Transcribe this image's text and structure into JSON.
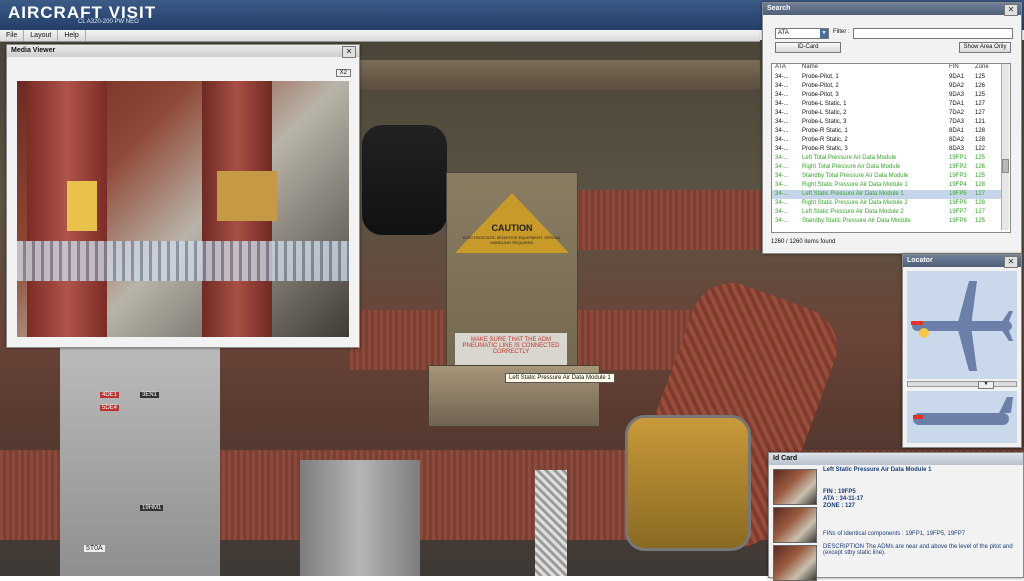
{
  "app": {
    "logo": "AIRCRAFT VISIT",
    "subtitle": "CL A320-200 PW NEO"
  },
  "menu": [
    {
      "label": "File"
    },
    {
      "label": "Layout"
    },
    {
      "label": "Help"
    }
  ],
  "media_viewer": {
    "title": "Media Viewer",
    "zoom_button": "X2"
  },
  "scene": {
    "caution_title": "CAUTION",
    "caution_text": "ELECTROSTATIC SENSITIVE EQUIPMENT. SPECIAL HANDLING REQUIRED",
    "adm_warning": "MAKE SURE THAT THE ADM PNEUMATIC LINE IS CONNECTED CORRECTLY",
    "tooltip": "Left Static Pressure Air Data Module 1",
    "labels": [
      "3EN1",
      "4DE1",
      "5DE4",
      "19HM1",
      "5T0A"
    ]
  },
  "search": {
    "title": "Search",
    "filter_type": "ATA",
    "filter_label": "Filter :",
    "filter_value": "",
    "id_card_button": "ID-Card",
    "show_area_button": "Show Area Only",
    "columns": {
      "ata": "ATA",
      "name": "Name",
      "fin": "FIN",
      "zone": "Zone"
    },
    "rows": [
      {
        "ata": "34-...",
        "name": "Probe-Pitot, 1",
        "fin": "9DA1",
        "zone": "125",
        "green": false,
        "selected": false
      },
      {
        "ata": "34-...",
        "name": "Probe-Pitot, 2",
        "fin": "9DA2",
        "zone": "126",
        "green": false,
        "selected": false
      },
      {
        "ata": "34-...",
        "name": "Probe-Pitot, 3",
        "fin": "9DA3",
        "zone": "125",
        "green": false,
        "selected": false
      },
      {
        "ata": "34-...",
        "name": "Probe-L Static, 1",
        "fin": "7DA1",
        "zone": "127",
        "green": false,
        "selected": false
      },
      {
        "ata": "34-...",
        "name": "Probe-L Static, 2",
        "fin": "7DA2",
        "zone": "127",
        "green": false,
        "selected": false
      },
      {
        "ata": "34-...",
        "name": "Probe-L Static, 3",
        "fin": "7DA3",
        "zone": "121",
        "green": false,
        "selected": false
      },
      {
        "ata": "34-...",
        "name": "Probe-R Static, 1",
        "fin": "8DA1",
        "zone": "128",
        "green": false,
        "selected": false
      },
      {
        "ata": "34-...",
        "name": "Probe-R Static, 2",
        "fin": "8DA2",
        "zone": "128",
        "green": false,
        "selected": false
      },
      {
        "ata": "34-...",
        "name": "Probe-R Static, 3",
        "fin": "8DA3",
        "zone": "122",
        "green": false,
        "selected": false
      },
      {
        "ata": "34-...",
        "name": "Left Total Pressure Air Data Module",
        "fin": "19FP1",
        "zone": "125",
        "green": true,
        "selected": false
      },
      {
        "ata": "34-...",
        "name": "Right Total Pressure Air Data Module",
        "fin": "19FP2",
        "zone": "126",
        "green": true,
        "selected": false
      },
      {
        "ata": "34-...",
        "name": "Standby Total Pressure Air Data Module",
        "fin": "19FP3",
        "zone": "125",
        "green": true,
        "selected": false
      },
      {
        "ata": "34-...",
        "name": "Right Static Pressure Air Data Module 1",
        "fin": "19FP4",
        "zone": "128",
        "green": true,
        "selected": false
      },
      {
        "ata": "34-...",
        "name": "Left Static Pressure Air Data Module 1",
        "fin": "19FP5",
        "zone": "127",
        "green": true,
        "selected": true
      },
      {
        "ata": "34-...",
        "name": "Right Static Pressure Air Data Module 2",
        "fin": "19FP6",
        "zone": "128",
        "green": true,
        "selected": false
      },
      {
        "ata": "34-...",
        "name": "Left Static Pressure Air Data Module 2",
        "fin": "19FP7",
        "zone": "127",
        "green": true,
        "selected": false
      },
      {
        "ata": "34-...",
        "name": "Standby Static Pressure Air Data Module",
        "fin": "19FP8",
        "zone": "125",
        "green": true,
        "selected": false
      }
    ],
    "status": "1260 / 1260 items found"
  },
  "locator": {
    "title": "Locator"
  },
  "id_card": {
    "title": "Id Card",
    "name": "Left Static Pressure Air Data Module 1",
    "fin": "FIN : 19FP5",
    "ata": "ATA : 34-11-17",
    "zone": "ZONE : 127",
    "identical": "FINs of identical components : 19FP1, 19FP5, 19FP7",
    "description": "DESCRIPTION The ADMs are near and above the level of the pitot and (except stby static line)."
  },
  "colors": {
    "header": "#2f4d78",
    "accent_green": "#39a52c",
    "selection": "#c6d5ea"
  }
}
